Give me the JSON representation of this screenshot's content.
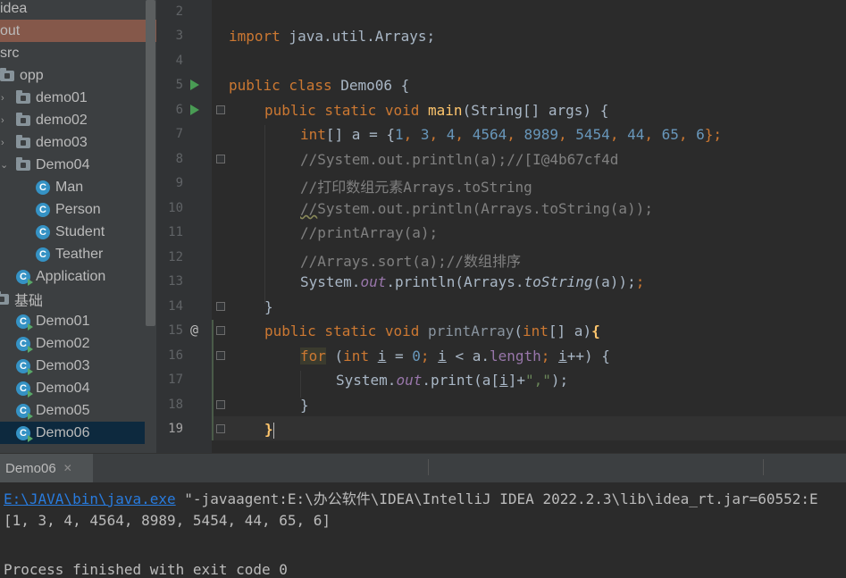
{
  "project_tree": {
    "items": [
      {
        "label": "idea",
        "type": "text"
      },
      {
        "label": "out",
        "type": "text"
      },
      {
        "label": "src",
        "type": "text"
      },
      {
        "label": "opp",
        "type": "folder"
      },
      {
        "label": "demo01",
        "type": "folder"
      },
      {
        "label": "demo02",
        "type": "folder"
      },
      {
        "label": "demo03",
        "type": "folder"
      },
      {
        "label": "Demo04",
        "type": "folder"
      },
      {
        "label": "Man",
        "type": "class"
      },
      {
        "label": "Person",
        "type": "class"
      },
      {
        "label": "Student",
        "type": "class"
      },
      {
        "label": "Teather",
        "type": "class"
      },
      {
        "label": "Application",
        "type": "runclass"
      },
      {
        "label": "基础",
        "type": "folder"
      },
      {
        "label": "Demo01",
        "type": "runclass"
      },
      {
        "label": "Demo02",
        "type": "runclass"
      },
      {
        "label": "Demo03",
        "type": "runclass"
      },
      {
        "label": "Demo04",
        "type": "runclass"
      },
      {
        "label": "Demo05",
        "type": "runclass"
      },
      {
        "label": "Demo06",
        "type": "runclass"
      }
    ],
    "class_icon_letter": "C"
  },
  "editor": {
    "line_numbers": [
      "2",
      "3",
      "4",
      "5",
      "6",
      "7",
      "8",
      "9",
      "10",
      "11",
      "12",
      "13",
      "14",
      "15",
      "16",
      "17",
      "18",
      "19"
    ],
    "override_marker": "@",
    "code": {
      "l3_import": "import",
      "l3_pkg": " java.util.Arrays;",
      "l5_public": "public",
      "l5_class": " class",
      "l5_name": " Demo06 {",
      "l6_mods": "public static void",
      "l6_main": "main",
      "l6_params": "(String[] args) {",
      "l7_int": "int",
      "l7_decl": "[] a = {",
      "l7_n1": "1",
      "l7_n2": "3",
      "l7_n3": "4",
      "l7_n4": "4564",
      "l7_n5": "8989",
      "l7_n6": "5454",
      "l7_n7": "44",
      "l7_n8": "65",
      "l7_n9": "6",
      "l7_comma": ", ",
      "l7_end": "};",
      "l8_comment": "//System.out.println(a);//[I@4b67cf4d",
      "l9_comment": "//打印数组元素Arrays.toString",
      "l10_slash": "//",
      "l10_comment": "System.out.println(Arrays.toString(a));",
      "l11_comment": "//printArray(a);",
      "l12_comment": "//Arrays.sort(a);//数组排序",
      "l13_sys": "System.",
      "l13_out": "out",
      "l13_p1": ".println(Arrays.",
      "l13_tostr": "toString",
      "l13_p2": "(a));",
      "l13_extra": ";",
      "l14_close": "}",
      "l15_mods": "public static void",
      "l15_name": " printArray",
      "l15_p1": "(",
      "l15_int": "int",
      "l15_p2": "[] a)",
      "l15_brace": "{",
      "l16_for": "for",
      "l16_p1": " (",
      "l16_int": "int",
      "l16_sp": " ",
      "l16_i": "i",
      "l16_eq": " = ",
      "l16_zero": "0",
      "l16_semi": "; ",
      "l16_i2": "i",
      "l16_lt": " < a.",
      "l16_length": "length",
      "l16_semi2": "; ",
      "l16_i3": "i",
      "l16_end": "++) {",
      "l17_sys": "System.",
      "l17_out": "out",
      "l17_p1": ".print(a[",
      "l17_i": "i",
      "l17_p2": "]+",
      "l17_str": "\",\"",
      "l17_p3": ");",
      "l18_close": "}",
      "l19_close": "}"
    }
  },
  "run_panel": {
    "tab_label": "Demo06",
    "close_glyph": "✕"
  },
  "console": {
    "exe_path": "E:\\JAVA\\bin\\java.exe",
    "args": " \"-javaagent:E:\\办公软件\\IDEA\\IntelliJ IDEA 2022.2.3\\lib\\idea_rt.jar=60552:E",
    "output": "[1, 3, 4, 4564, 8989, 5454, 44, 65, 6]",
    "exit_message": "Process finished with exit code 0"
  },
  "colors": {
    "keyword": "#cc7832",
    "number": "#6897bb",
    "comment": "#808080",
    "method": "#ffc66d",
    "field": "#9876aa",
    "string": "#6a8759",
    "selection": "#0d293e",
    "highlight": "#85584a"
  }
}
